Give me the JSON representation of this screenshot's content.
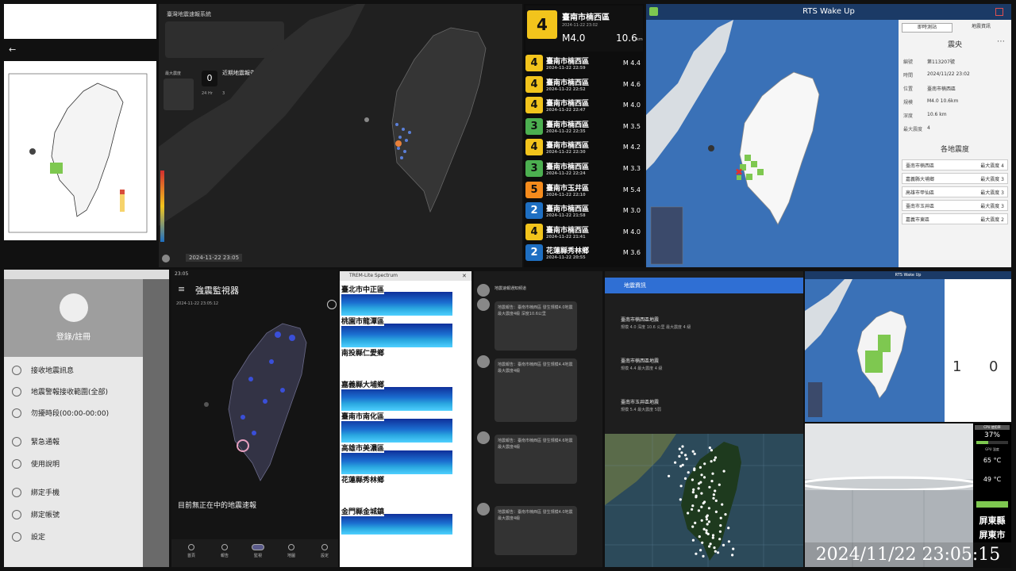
{
  "panel2": {
    "title": "臺灣地震速報系統",
    "shake_label": "最大震度",
    "count": "0",
    "event_title": "近期地震報告",
    "time_label": "24 Hr",
    "time_value": "3",
    "timestamp": "2024-11-22 23:05"
  },
  "eq_main": {
    "intensity": "4",
    "location": "臺南市楠西區",
    "time": "2024-11-22 23:02",
    "magnitude": "M4.0",
    "depth": "10.6",
    "depth_unit": "km"
  },
  "eq_list": [
    {
      "intensity": "4",
      "location": "臺南市楠西區",
      "time": "2024-11-22 22:59",
      "mag": "M 4.4",
      "color": "#f2c41c"
    },
    {
      "intensity": "4",
      "location": "臺南市楠西區",
      "time": "2024-11-22 22:52",
      "mag": "M 4.6",
      "color": "#f2c41c"
    },
    {
      "intensity": "4",
      "location": "臺南市楠西區",
      "time": "2024-11-22 22:47",
      "mag": "M 4.0",
      "color": "#f2c41c"
    },
    {
      "intensity": "3",
      "location": "臺南市楠西區",
      "time": "2024-11-22 22:35",
      "mag": "M 3.5",
      "color": "#4caf50"
    },
    {
      "intensity": "4",
      "location": "臺南市楠西區",
      "time": "2024-11-22 22:30",
      "mag": "M 4.2",
      "color": "#f2c41c"
    },
    {
      "intensity": "3",
      "location": "臺南市楠西區",
      "time": "2024-11-22 22:24",
      "mag": "M 3.3",
      "color": "#4caf50"
    },
    {
      "intensity": "5",
      "location": "臺南市玉井區",
      "time": "2024-11-22 22:10",
      "mag": "M 5.4",
      "color": "#f58b1c"
    },
    {
      "intensity": "2",
      "location": "臺南市楠西區",
      "time": "2024-11-22 21:58",
      "mag": "M 3.0",
      "color": "#1e6fc2"
    },
    {
      "intensity": "4",
      "location": "臺南市楠西區",
      "time": "2024-11-22 21:41",
      "mag": "M 4.0",
      "color": "#f2c41c"
    },
    {
      "intensity": "2",
      "location": "花蓮縣秀林鄉",
      "time": "2024-11-22 20:55",
      "mag": "M 3.6",
      "color": "#1e6fc2"
    }
  ],
  "panel4": {
    "title": "RTS Wake Up",
    "tab1": "即時測站",
    "tab2": "地震資訊",
    "section_title": "震央",
    "kv": [
      {
        "k": "編號",
        "v": "第113207號"
      },
      {
        "k": "時間",
        "v": "2024/11/22 23:02"
      },
      {
        "k": "位置",
        "v": "臺南市楠西區"
      },
      {
        "k": "規模",
        "v": "M4.0 10.6km"
      },
      {
        "k": "深度",
        "v": "10.6 km"
      },
      {
        "k": "最大震度",
        "v": "4"
      }
    ],
    "station_title": "各地震度",
    "stations": [
      {
        "name": "臺南市楠西區",
        "val": "最大震度 4"
      },
      {
        "name": "嘉義縣大埔鄉",
        "val": "最大震度 3"
      },
      {
        "name": "高雄市甲仙區",
        "val": "最大震度 3"
      },
      {
        "name": "臺南市玉井區",
        "val": "最大震度 3"
      },
      {
        "name": "嘉義市東區",
        "val": "最大震度 2"
      }
    ]
  },
  "panel5": {
    "profile": "登錄/註冊",
    "items": [
      "接收地震訊息",
      "地震警報接收範圍(全部)",
      "勿擾時段(00:00-00:00)",
      "緊急通報",
      "使用說明",
      "綁定手機",
      "綁定帳號",
      "設定"
    ]
  },
  "panel6": {
    "time": "23:05",
    "title": "強震監視器",
    "subtitle": "2024-11-22 23:05:12",
    "status": "目前無正在中的地震速報",
    "nav": [
      "首頁",
      "報告",
      "監視",
      "地圖",
      "設定"
    ]
  },
  "panel7": {
    "title": "TREM-Lite Spectrum",
    "stations": [
      "臺北市中正區",
      "桃園市龍潭區",
      "南投縣仁愛鄉",
      "嘉義縣大埔鄉",
      "臺南市南化區",
      "高雄市美濃區",
      "花蓮縣秀林鄉",
      "金門縣金城鎮"
    ]
  },
  "panel8": {
    "channel": "地震速報通知頻道",
    "messages": [
      "地震報告：臺南市楠西區 發生規模4.0地震 最大震度4級 深度10.6公里",
      "地震報告：臺南市楠西區 發生規模4.4地震 最大震度4級",
      "地震報告：臺南市楠西區 發生規模4.6地震 最大震度4級",
      "地震報告：臺南市楠西區 發生規模4.0地震 最大震度4級"
    ]
  },
  "panel9": {
    "header": "地震資訊",
    "items": [
      {
        "title": "臺南市楠西區地震",
        "body": "規模 4.0 深度 10.6 公里 最大震度 4 級"
      },
      {
        "title": "臺南市楠西區地震",
        "body": "規模 4.4 最大震度 4 級"
      },
      {
        "title": "臺南市玉井區地震",
        "body": "規模 5.4 最大震度 5弱"
      }
    ]
  },
  "panel10": {
    "title": "RTS Wake Up",
    "count_left": "1",
    "count_right": "0"
  },
  "panel12": {
    "cpu_label": "CPU 使用率",
    "cpu": "37%",
    "gpu_label": "GPU 溫度",
    "temp1": "65 °C",
    "temp2": "49 °C",
    "city1": "屏東縣",
    "city2": "屏東市"
  },
  "clock": "2024/11/22 23:05:15",
  "colors": {
    "accent": "#f2c41c",
    "blue": "#1e6fc2",
    "green": "#4caf50",
    "orange": "#f58b1c"
  }
}
